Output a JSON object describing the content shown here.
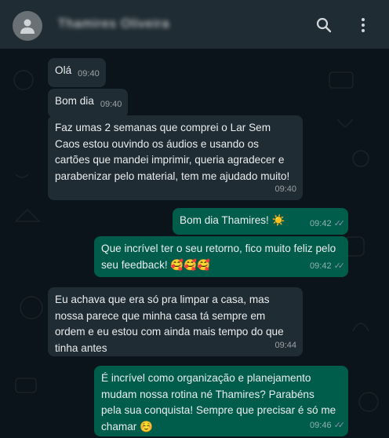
{
  "header": {
    "contact_name": "Thamires Oliveira"
  },
  "messages": [
    {
      "text": "Olá",
      "time": "09:40",
      "direction": "in"
    },
    {
      "text": "Bom dia",
      "time": "09:40",
      "direction": "in"
    },
    {
      "text": "Faz umas 2 semanas que comprei o Lar Sem Caos estou ouvindo os áudios e usando os cartões que mandei imprimir, queria agradecer e parabenizar pelo material, tem me ajudado muito!",
      "time": "09:40",
      "direction": "in"
    },
    {
      "text": "Bom dia Thamires! ☀️",
      "time": "09:42",
      "direction": "out"
    },
    {
      "text": "Que incrível ter o seu retorno, fico muito feliz pelo seu feedback! 🥰🥰🥰",
      "time": "09:42",
      "direction": "out"
    },
    {
      "text": "Eu achava que era só pra limpar a casa, mas nossa parece que minha casa tá sempre em ordem e eu estou com ainda mais tempo do que tinha antes",
      "time": "09:44",
      "direction": "in"
    },
    {
      "text": "É incrível como organização e planejamento mudam nossa rotina né Thamires? Parabéns pela sua conquista! Sempre que precisar é só me chamar ☺️",
      "time": "09:46",
      "direction": "out"
    }
  ],
  "colors": {
    "background": "#0b141a",
    "header": "#202c33",
    "incoming_bubble": "#202c33",
    "outgoing_bubble": "#005c4b",
    "read_ticks": "#8696a0"
  },
  "icons": [
    "avatar-icon",
    "search-icon",
    "menu-icon",
    "double-check-icon"
  ]
}
